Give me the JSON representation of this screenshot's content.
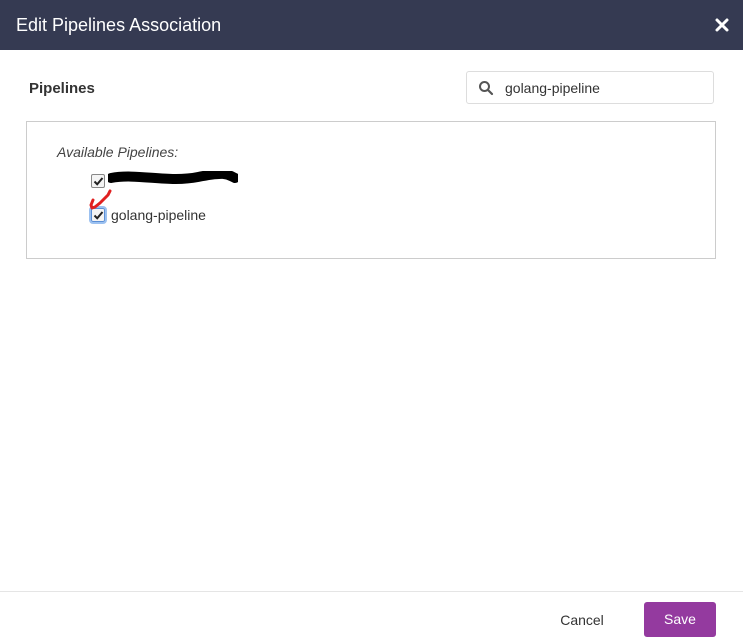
{
  "dialog": {
    "title": "Edit Pipelines Association",
    "close_icon": "close-icon"
  },
  "pipelines_section": {
    "label": "Pipelines",
    "search": {
      "icon": "search-icon",
      "value": "golang-pipeline"
    }
  },
  "available": {
    "label": "Available Pipelines:",
    "items": [
      {
        "label": "",
        "checked": true,
        "redacted": true
      },
      {
        "label": "golang-pipeline",
        "checked": true,
        "focused": true
      }
    ]
  },
  "footer": {
    "cancel_label": "Cancel",
    "save_label": "Save"
  },
  "colors": {
    "header_bg": "#353a52",
    "save_bg": "#943a9f",
    "annotation": "#e02020"
  }
}
